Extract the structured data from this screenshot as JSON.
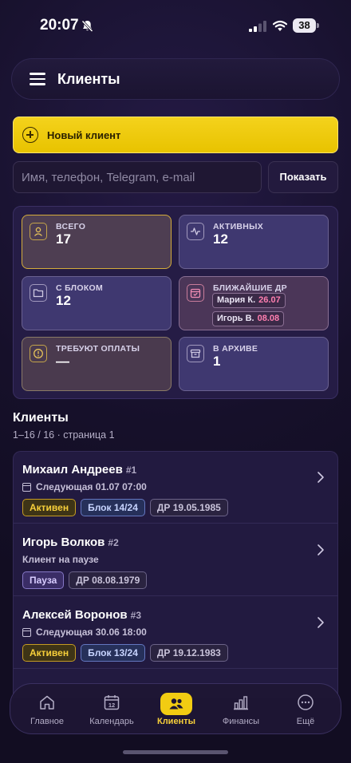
{
  "status_bar": {
    "time": "20:07",
    "battery": "38"
  },
  "header": {
    "title": "Клиенты"
  },
  "new_client": {
    "label": "Новый клиент"
  },
  "search": {
    "placeholder": "Имя, телефон, Telegram, e-mail",
    "button_label": "Показать"
  },
  "stats": {
    "total": {
      "label": "ВСЕГО",
      "value": "17"
    },
    "active": {
      "label": "АКТИВНЫХ",
      "value": "12"
    },
    "with_block": {
      "label": "С БЛОКОМ",
      "value": "12"
    },
    "birthdays": {
      "label": "БЛИЖАЙШИЕ ДР",
      "items": [
        {
          "name": "Мария К.",
          "date": "26.07"
        },
        {
          "name": "Игорь В.",
          "date": "08.08"
        }
      ]
    },
    "need_payment": {
      "label": "ТРЕБУЮТ ОПЛАТЫ",
      "value": "—"
    },
    "archive": {
      "label": "В АРХИВЕ",
      "value": "1"
    }
  },
  "list": {
    "title": "Клиенты",
    "subtitle": "1–16 / 16 · страница 1",
    "clients": [
      {
        "name": "Михаил Андреев",
        "num": "#1",
        "sub": "Следующая 01.07 07:00",
        "status": "Активен",
        "block": "Блок 14/24",
        "dr": "ДР 19.05.1985"
      },
      {
        "name": "Игорь Волков",
        "num": "#2",
        "sub": "Клиент на паузе",
        "status": "Пауза",
        "dr": "ДР 08.08.1979"
      },
      {
        "name": "Алексей Воронов",
        "num": "#3",
        "sub": "Следующая 30.06 18:00",
        "status": "Активен",
        "block": "Блок 13/24",
        "dr": "ДР 19.12.1983"
      }
    ]
  },
  "nav": {
    "items": [
      {
        "label": "Главное",
        "icon": "home-icon"
      },
      {
        "label": "Календарь",
        "icon": "calendar-icon",
        "icon_text": "12"
      },
      {
        "label": "Клиенты",
        "icon": "users-icon",
        "active": true
      },
      {
        "label": "Финансы",
        "icon": "bar-chart-icon"
      },
      {
        "label": "Ещё",
        "icon": "more-icon"
      }
    ]
  },
  "colors": {
    "accent": "#f2cc12",
    "background": "#16102a",
    "birthday_date": "#ff7fb0"
  }
}
